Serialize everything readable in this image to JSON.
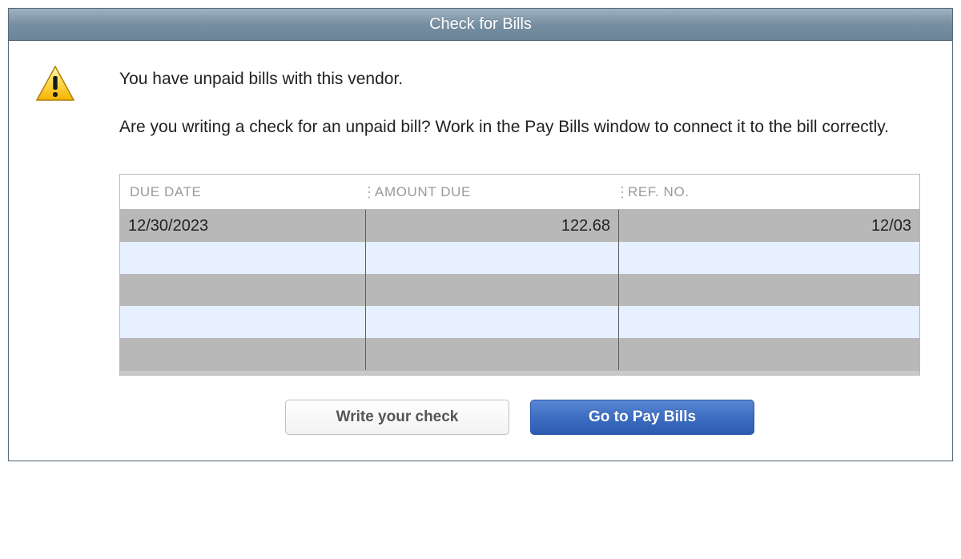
{
  "window": {
    "title": "Check for Bills"
  },
  "messages": {
    "main": "You have unpaid bills with this vendor.",
    "sub": "Are you writing a check for an unpaid bill? Work in the Pay Bills window to connect it to the bill correctly."
  },
  "table": {
    "headers": {
      "due_date": "DUE DATE",
      "amount_due": "AMOUNT DUE",
      "ref_no": "REF. NO."
    },
    "rows": [
      {
        "due_date": "12/30/2023",
        "amount_due": "122.68",
        "ref_no": "12/03"
      },
      {
        "due_date": "",
        "amount_due": "",
        "ref_no": ""
      },
      {
        "due_date": "",
        "amount_due": "",
        "ref_no": ""
      },
      {
        "due_date": "",
        "amount_due": "",
        "ref_no": ""
      },
      {
        "due_date": "",
        "amount_due": "",
        "ref_no": ""
      }
    ]
  },
  "buttons": {
    "write_check": "Write your check",
    "go_to_pay_bills": "Go to Pay Bills"
  }
}
